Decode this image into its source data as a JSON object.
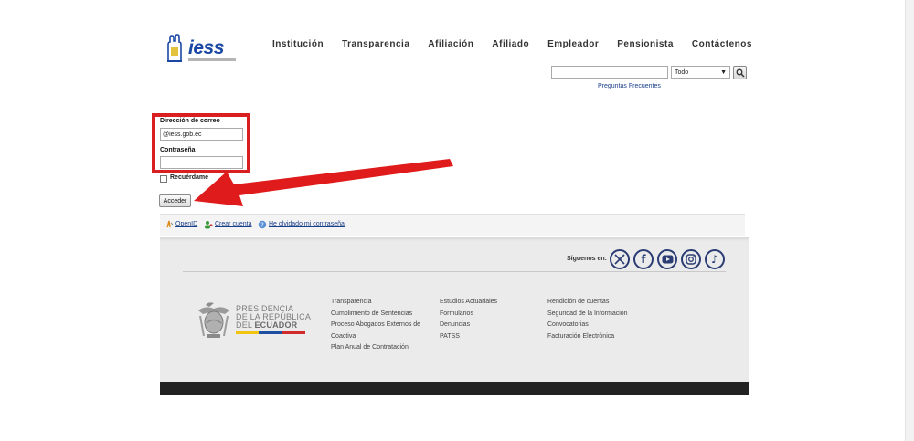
{
  "brand": {
    "logo_text": "iess"
  },
  "nav": [
    "Institución",
    "Transparencia",
    "Afiliación",
    "Afiliado",
    "Empleador",
    "Pensionista",
    "Contáctenos"
  ],
  "search": {
    "value": "",
    "select_value": "Todo",
    "faq_link": "Preguntas Frecuentes"
  },
  "login": {
    "email_label": "Dirección de correo",
    "email_value": "@iess.gob.ec",
    "password_label": "Contraseña",
    "remember_label": "Recuérdame",
    "submit_label": "Acceder"
  },
  "links": {
    "openid": "OpenID",
    "create_account": "Crear cuenta",
    "forgot_password": "He olvidado mi contraseña"
  },
  "footer": {
    "follow_label": "Síguenos en:",
    "social": [
      "x-icon",
      "facebook-icon",
      "youtube-icon",
      "instagram-icon",
      "tiktok-icon"
    ],
    "gov": {
      "line1": "PRESIDENCIA",
      "line2": "DE LA REPÚBLICA",
      "line3_prefix": "DEL",
      "line3_bold": "ECUADOR"
    },
    "col1": [
      "Transparencia",
      "Cumplimiento de Sentencias",
      "Proceso Abogados Externos de",
      "Coactiva",
      "Plan Anual de Contratación"
    ],
    "col2": [
      "Estudios Actuariales",
      "Formularios",
      "Denuncias",
      "PATSS"
    ],
    "col3": [
      "Rendición de cuentas",
      "Seguridad de la Información",
      "Convocatorias",
      "Facturación Electrónica"
    ]
  },
  "colors": {
    "highlight": "#d91f1f",
    "link": "#1a3f8a",
    "brand": "#1a47a3",
    "social": "#2a3c73"
  }
}
